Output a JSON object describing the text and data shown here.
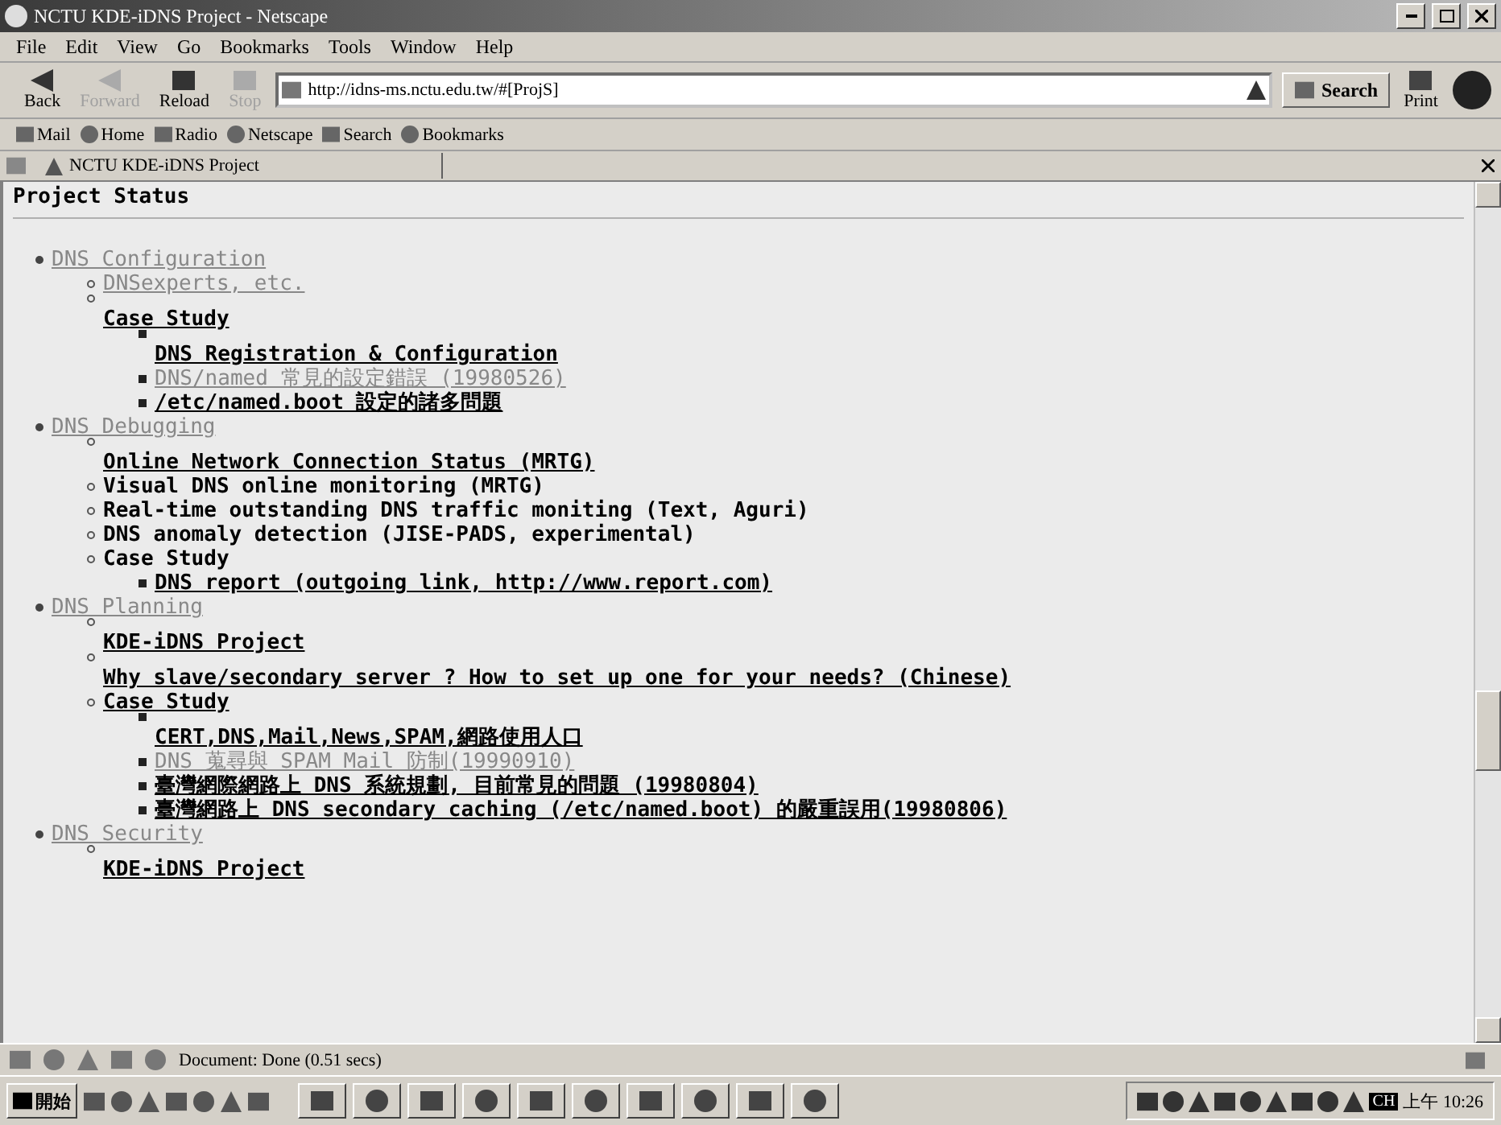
{
  "window": {
    "title": "NCTU KDE-iDNS Project - Netscape"
  },
  "menu": [
    "File",
    "Edit",
    "View",
    "Go",
    "Bookmarks",
    "Tools",
    "Window",
    "Help"
  ],
  "nav_buttons": [
    {
      "label": "Back",
      "disabled": false
    },
    {
      "label": "Forward",
      "disabled": true
    },
    {
      "label": "Reload",
      "disabled": false
    },
    {
      "label": "Stop",
      "disabled": true
    }
  ],
  "address": "http://idns-ms.nctu.edu.tw/#[ProjS]",
  "search_button": "Search",
  "print_button": "Print",
  "personal_toolbar": [
    "Mail",
    "Home",
    "Radio",
    "Netscape",
    "Search",
    "Bookmarks"
  ],
  "tab": {
    "title": "NCTU KDE-iDNS Project"
  },
  "page": {
    "heading": "Project Status",
    "outline": [
      {
        "text": "DNS Configuration",
        "kind": "visited",
        "bullet_above": false,
        "children": [
          {
            "text": "DNSexperts, etc.",
            "kind": "visited",
            "bullet_above": false
          },
          {
            "text": "Case Study",
            "kind": "link",
            "bullet_above": true,
            "children": [
              {
                "text": "DNS Registration & Configuration",
                "kind": "link",
                "bullet_above": true
              },
              {
                "text": "DNS/named 常見的設定錯誤 (19980526)",
                "kind": "visited",
                "bullet_above": false
              },
              {
                "text": "/etc/named.boot 設定的諸多問題",
                "kind": "link",
                "bullet_above": false
              }
            ]
          }
        ]
      },
      {
        "text": "DNS Debugging",
        "kind": "visited",
        "bullet_above": false,
        "children": [
          {
            "text": "Online Network Connection Status (MRTG)",
            "kind": "link",
            "bullet_above": true
          },
          {
            "text": "Visual DNS online monitoring (MRTG)",
            "kind": "text",
            "bullet_above": false
          },
          {
            "text": "Real-time outstanding DNS traffic moniting (Text, Aguri)",
            "kind": "text",
            "bullet_above": false
          },
          {
            "text": "DNS anomaly detection (JISE-PADS, experimental)",
            "kind": "text",
            "bullet_above": false
          },
          {
            "text": "Case Study",
            "kind": "text",
            "bullet_above": false,
            "children": [
              {
                "text": "DNS report (outgoing link, http://www.report.com)",
                "kind": "link",
                "bullet_above": false
              }
            ]
          }
        ]
      },
      {
        "text": "DNS Planning",
        "kind": "visited",
        "bullet_above": false,
        "children": [
          {
            "text": "KDE-iDNS Project",
            "kind": "link",
            "bullet_above": true
          },
          {
            "text": "Why slave/secondary server ? How to set up one for your needs? (Chinese)",
            "kind": "link",
            "bullet_above": true
          },
          {
            "text": "Case Study",
            "kind": "link",
            "bullet_above": false,
            "children": [
              {
                "text": "CERT,DNS,Mail,News,SPAM,網路使用人口",
                "kind": "link",
                "bullet_above": true
              },
              {
                "text": "DNS 蒐尋與 SPAM Mail 防制(19990910)",
                "kind": "visited",
                "bullet_above": false
              },
              {
                "text": "臺灣網際網路上 DNS 系統規劃, 目前常見的問題 (19980804)",
                "kind": "link",
                "bullet_above": false
              },
              {
                "text": "臺灣網路上 DNS secondary caching (/etc/named.boot) 的嚴重誤用(19980806)",
                "kind": "link",
                "bullet_above": false
              }
            ]
          }
        ]
      },
      {
        "text": "DNS Security",
        "kind": "visited",
        "bullet_above": false,
        "children": [
          {
            "text": "KDE-iDNS Project",
            "kind": "link",
            "bullet_above": true
          }
        ]
      }
    ]
  },
  "status": "Document: Done (0.51 secs)",
  "taskbar": {
    "start": "開始",
    "language": "CH",
    "clock": "上午 10:26"
  }
}
